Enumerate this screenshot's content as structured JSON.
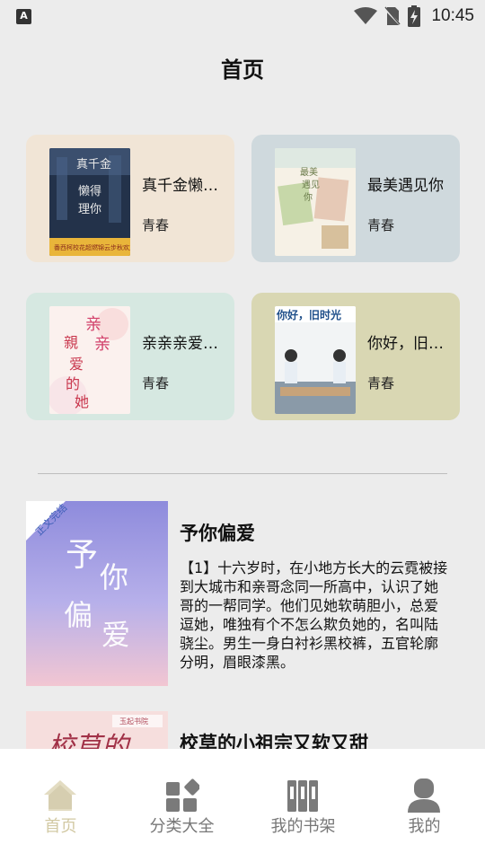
{
  "status_bar": {
    "left_badge": "A",
    "time": "10:45"
  },
  "header": {
    "title": "首页"
  },
  "featured": [
    {
      "title": "真千金懒得理你",
      "tag": "青春",
      "bg": "#f1e5d6",
      "cover_text": "真千金懒得理你"
    },
    {
      "title": "最美遇见你",
      "tag": "青春",
      "bg": "#cfd9dd",
      "cover_text": "最美遇见你"
    },
    {
      "title": "亲亲亲爱的她",
      "tag": "青春",
      "bg": "#d6e8e1",
      "cover_text": "亲亲亲爱的她"
    },
    {
      "title": "你好，旧时光",
      "tag": "青春",
      "bg": "#d9d7b3",
      "cover_text": "你好，旧时光"
    }
  ],
  "list": [
    {
      "title": "予你偏爱",
      "desc": "【1】十六岁时，在小地方长大的云霓被接到大城市和亲哥念同一所高中，认识了她哥的一帮同学。他们见她软萌胆小，总爱逗她，唯独有个不怎么欺负她的，名叫陆骁尘。男生一身白衬衫黑校裤，五官轮廓分明，眉眼漆黑。",
      "cover_text": "予你偏爱",
      "ribbon": "正文完结"
    },
    {
      "title": "校草的小祖宗又软又甜",
      "desc": "",
      "cover_text": "校草的",
      "ribbon": "玉起书院"
    }
  ],
  "bottom_nav": {
    "items": [
      {
        "label": "首页",
        "icon": "home-icon",
        "active": true
      },
      {
        "label": "分类大全",
        "icon": "category-icon",
        "active": false
      },
      {
        "label": "我的书架",
        "icon": "bookshelf-icon",
        "active": false
      },
      {
        "label": "我的",
        "icon": "profile-icon",
        "active": false
      }
    ],
    "active_color": "#d2c9a3",
    "inactive_color": "#777777"
  }
}
